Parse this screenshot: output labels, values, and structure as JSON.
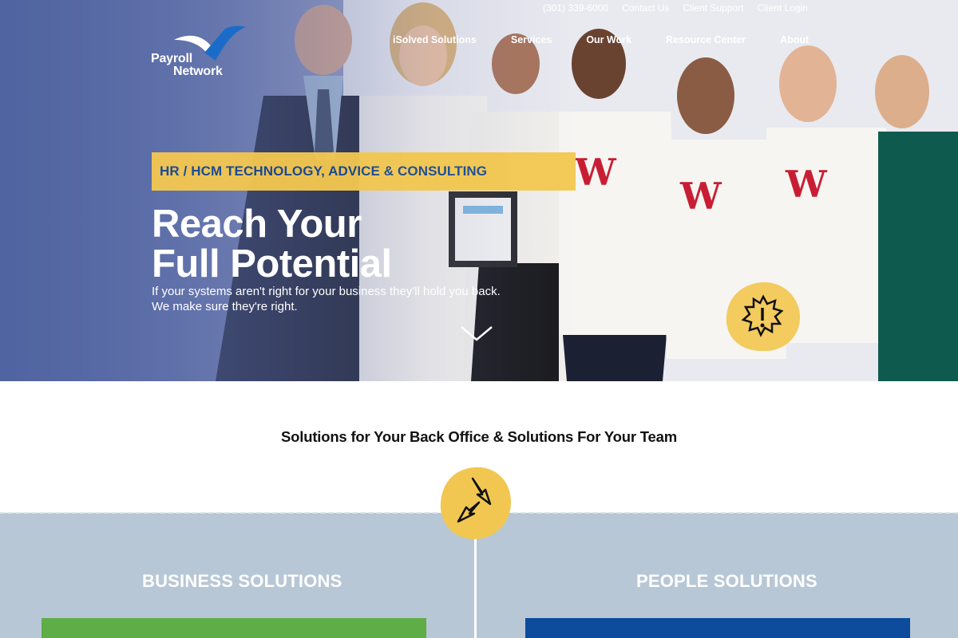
{
  "brand": {
    "line1": "Payroll",
    "line2": "Network",
    "colors": {
      "accent_yellow": "#f2c751",
      "brand_blue": "#1b4a93",
      "green": "#5fad46",
      "navy": "#0d4b9c",
      "slate": "#b7c7d6"
    }
  },
  "utility_nav": {
    "phone": "(301) 339-6000",
    "contact": "Contact Us",
    "support": "Client Support",
    "login": "Client Login"
  },
  "main_nav": {
    "items": [
      {
        "label": "iSolved Solutions"
      },
      {
        "label": "Services"
      },
      {
        "label": "Our Work"
      },
      {
        "label": "Resource Center"
      },
      {
        "label": "About"
      }
    ]
  },
  "hero": {
    "tagline": "HR / HCM TECHNOLOGY, ADVICE & CONSULTING",
    "headline_line1": "Reach Your",
    "headline_line2": "Full Potential",
    "sub_line1": "If your systems aren't right for your business they'll hold you back.",
    "sub_line2": "We make sure they're right.",
    "icons": {
      "scroll": "chevron-down-icon",
      "alert": "alert-badge-icon"
    }
  },
  "solutions": {
    "title": "Solutions for Your Back Office & Solutions For Your Team",
    "icon": "swap-arrows-icon",
    "left_title": "BUSINESS SOLUTIONS",
    "right_title": "PEOPLE SOLUTIONS"
  }
}
